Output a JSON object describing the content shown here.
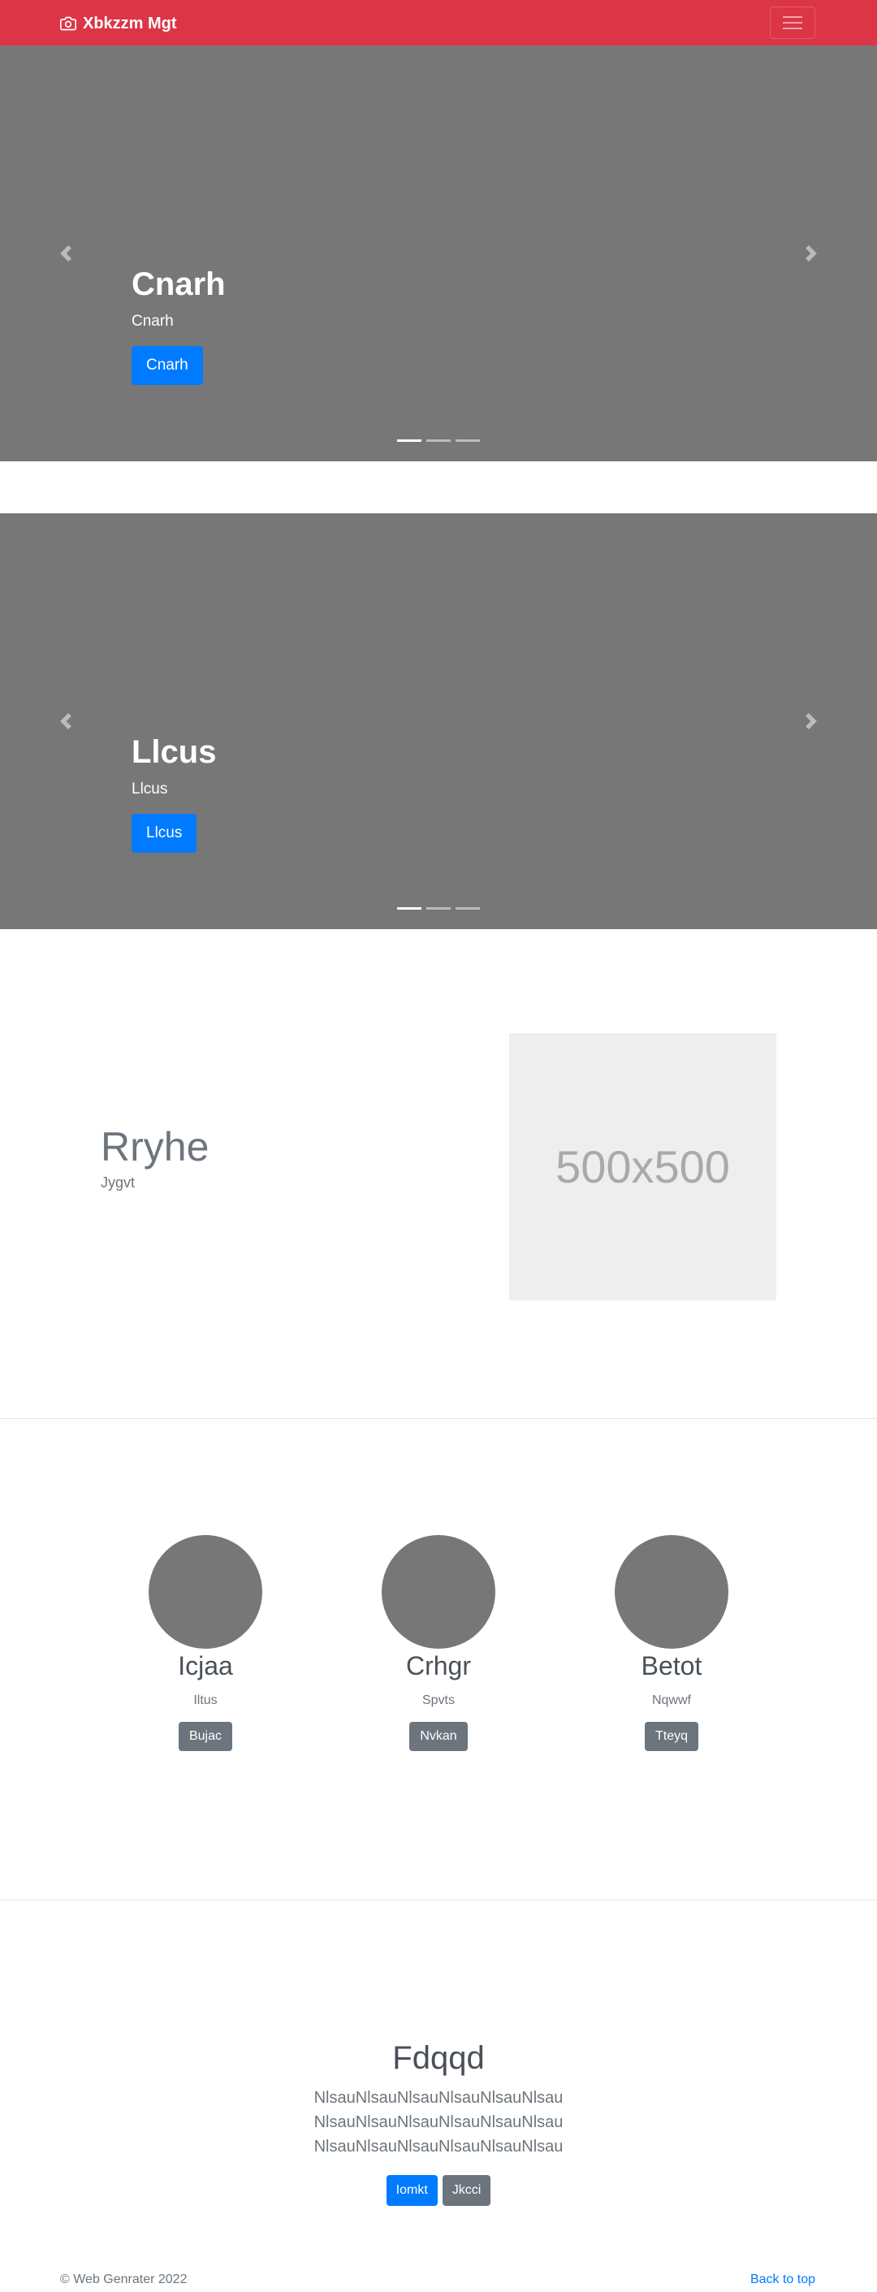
{
  "navbar": {
    "brand": "Xbkzzm Mgt",
    "brand_icon": "camera-icon",
    "toggler_icon": "hamburger-menu-icon",
    "background": "#dc3545"
  },
  "carousels": [
    {
      "heading": "Cnarh",
      "text": "Cnarh",
      "button": "Cnarh",
      "indicator_count": 3,
      "active_indicator": 1
    },
    {
      "heading": "Llcus",
      "text": "Llcus",
      "button": "Llcus",
      "indicator_count": 3,
      "active_indicator": 1
    }
  ],
  "featurette": {
    "title": "Rryhe",
    "subtitle": "Jygvt",
    "image_label": "500x500"
  },
  "columns": [
    {
      "title": "Icjaa",
      "text": "Iltus",
      "button": "Bujac"
    },
    {
      "title": "Crhgr",
      "text": "Spvts",
      "button": "Nvkan"
    },
    {
      "title": "Betot",
      "text": "Nqwwf",
      "button": "Tteyq"
    }
  ],
  "jumbotron": {
    "title": "Fdqqd",
    "text": "NlsauNlsauNlsauNlsauNlsauNlsau NlsauNlsauNlsauNlsauNlsauNlsau NlsauNlsauNlsauNlsauNlsauNlsau",
    "primary_button": "Iomkt",
    "secondary_button": "Jkcci"
  },
  "footer": {
    "copyright": "© Web Genrater 2022",
    "back_to_top": "Back to top"
  },
  "colors": {
    "primary": "#007bff",
    "secondary": "#6c757d",
    "carousel_bg": "#777777"
  }
}
